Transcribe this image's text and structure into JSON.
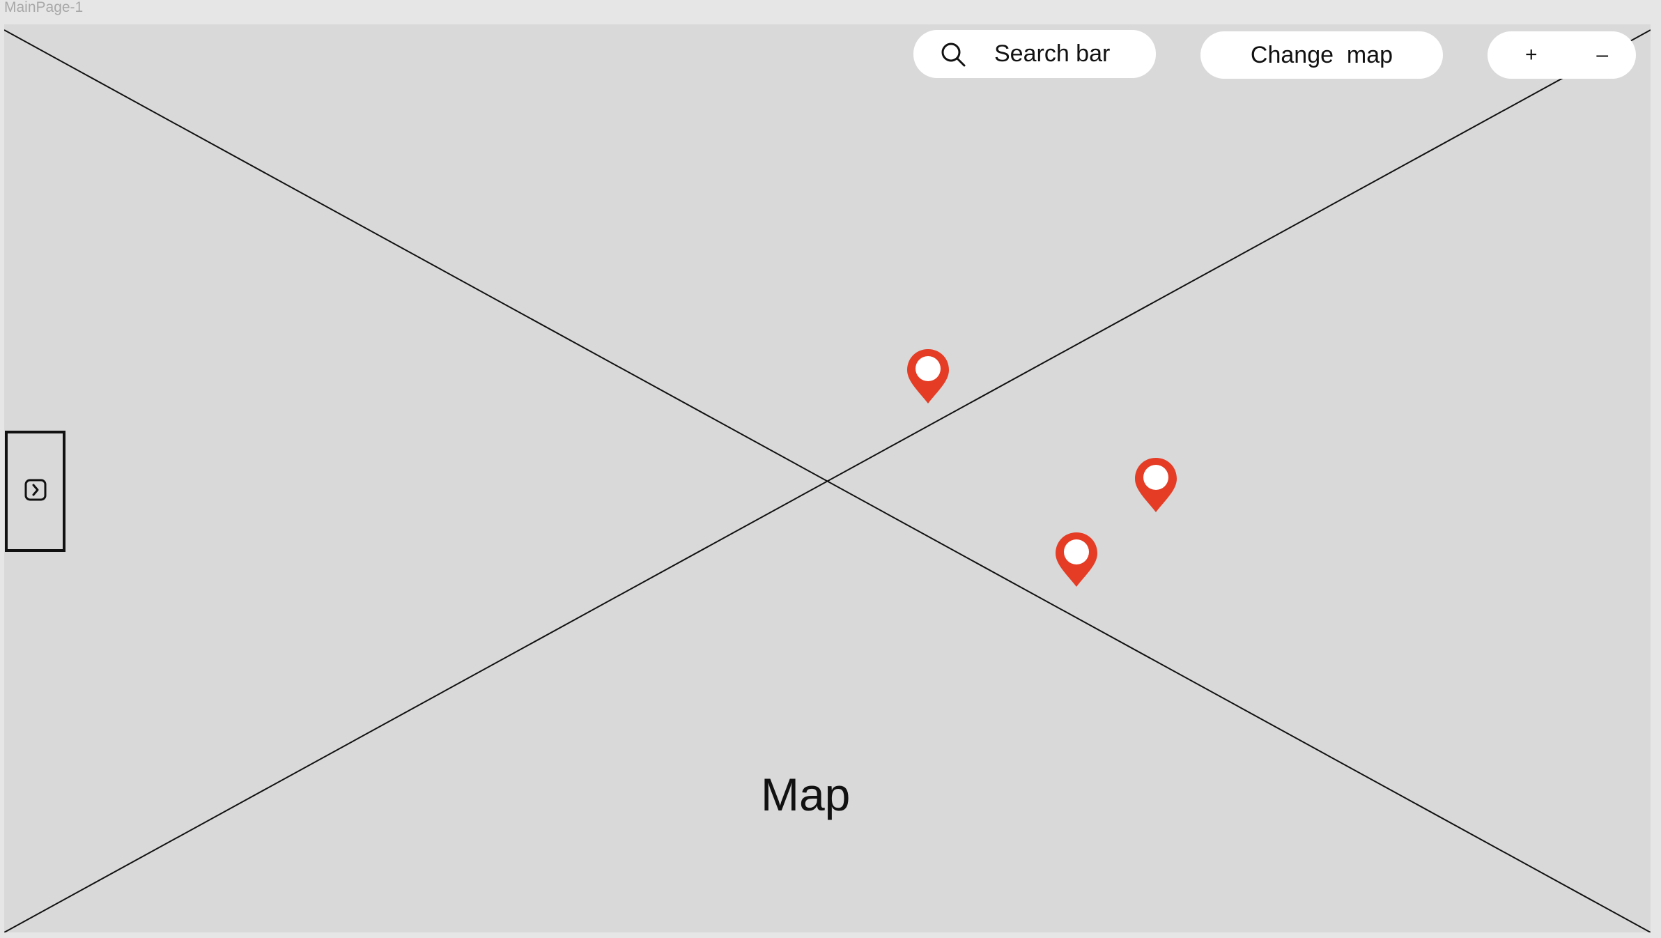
{
  "frame": {
    "label": "MainPage-1"
  },
  "map": {
    "label": "Map",
    "background_color": "#d9d9d9",
    "pins": [
      {
        "name": "map-pin-1",
        "color": "#e53c25"
      },
      {
        "name": "map-pin-2",
        "color": "#e53c25"
      },
      {
        "name": "map-pin-3",
        "color": "#e53c25"
      }
    ]
  },
  "toolbar": {
    "search": {
      "icon": "search-icon",
      "label": "Search bar"
    },
    "change_map_label": "Change  map",
    "zoom_in_label": "+",
    "zoom_out_label": "–"
  },
  "sidebar_toggle": {
    "icon": "chevron-right-icon"
  }
}
